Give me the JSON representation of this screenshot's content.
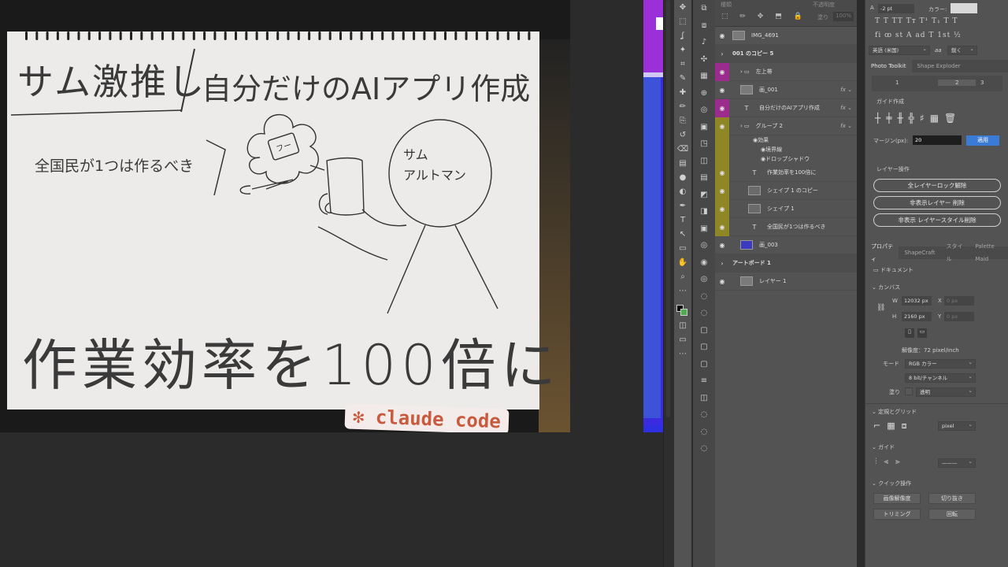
{
  "canvas": {
    "sketch": {
      "title_left": "サム激推し",
      "title_right": "自分だけのAIアプリ作成",
      "left_note": "全国民が1つは作るべき",
      "flower_label": "フー",
      "head_label": "サム\nアルトマン",
      "bottom_text": "作業効率を100倍に"
    },
    "sticker_text": "✻ claude code"
  },
  "toolbar": {
    "tools": [
      "move-icon",
      "marquee-icon",
      "lasso-icon",
      "magic-wand-icon",
      "crop-icon",
      "eyedropper-icon",
      "healing-icon",
      "brush-icon",
      "stamp-icon",
      "history-brush-icon",
      "eraser-icon",
      "gradient-icon",
      "blur-icon",
      "dodge-icon",
      "pen-icon",
      "type-icon",
      "path-select-icon",
      "rectangle-icon",
      "hand-icon",
      "zoom-icon",
      "more-icon"
    ],
    "tool_glyphs": [
      "✥",
      "⬚",
      "ʆ",
      "✦",
      "⌗",
      "✎",
      "✚",
      "✏",
      "⎘",
      "↺",
      "⌫",
      "▤",
      "●",
      "◐",
      "✒",
      "T",
      "↖",
      "▭",
      "✋",
      "⌕",
      "⋯"
    ]
  },
  "mini_panel": {
    "glyphs": [
      "⧉",
      "⧈",
      "♪",
      "✣",
      "▦",
      "⊕",
      "◎",
      "▣",
      "◳",
      "◫",
      "▤",
      "◩",
      "◨",
      "▣",
      "◎",
      "◉",
      "◎",
      "◌",
      "◌",
      "▢",
      "▢",
      "▢",
      "≡",
      "◫",
      "◌",
      "◌",
      "◌"
    ]
  },
  "layers": {
    "top_left_label": "種類",
    "top_right_label": "不透明度",
    "fill_label": "塗り",
    "fill_value": "100%",
    "lock_glyphs": "⬚ ✏ ✥ ⬒ 🔒",
    "rows": [
      {
        "name": "IMG_4691",
        "kind": "thumb",
        "indent": 0,
        "eye": true,
        "tag": "",
        "fx": false
      },
      {
        "name": "001 のコピー 5",
        "kind": "group-header",
        "indent": 0,
        "eye": false,
        "tag": "",
        "fx": false
      },
      {
        "name": "左上帯",
        "kind": "folder",
        "indent": 1,
        "eye": true,
        "tag": "#9b2b8d",
        "fx": false
      },
      {
        "name": "画_001",
        "kind": "thumb",
        "indent": 1,
        "eye": true,
        "tag": "",
        "fx": true
      },
      {
        "name": "自分だけのAIアプリ作成",
        "kind": "text",
        "indent": 1,
        "eye": true,
        "tag": "#9b2b8d",
        "fx": true
      },
      {
        "name": "グループ 2",
        "kind": "folder",
        "indent": 1,
        "eye": true,
        "tag": "#8f8726",
        "fx": true
      },
      {
        "name": "作業効率を100倍に",
        "kind": "text",
        "indent": 2,
        "eye": true,
        "tag": "#8f8726",
        "fx": false
      },
      {
        "name": "シェイプ 1 のコピー",
        "kind": "shape",
        "indent": 2,
        "eye": true,
        "tag": "#8f8726",
        "fx": false
      },
      {
        "name": "シェイプ 1",
        "kind": "shape",
        "indent": 2,
        "eye": true,
        "tag": "#8f8726",
        "fx": false
      },
      {
        "name": "全国民が1つは作るべき",
        "kind": "text",
        "indent": 2,
        "eye": true,
        "tag": "#8f8726",
        "fx": false
      },
      {
        "name": "画_003",
        "kind": "thumb",
        "indent": 1,
        "eye": true,
        "tag": "",
        "fx": false
      },
      {
        "name": "アートボード 1",
        "kind": "group-header",
        "indent": 0,
        "eye": false,
        "tag": "",
        "fx": false
      },
      {
        "name": "レイヤー 1",
        "kind": "thumb",
        "indent": 1,
        "eye": true,
        "tag": "",
        "fx": false
      }
    ],
    "effects_label": "効果",
    "effect_items": [
      "境界線",
      "ドロップシャドウ"
    ]
  },
  "right_panel": {
    "char_size": "-2 pt",
    "color_label": "カラー:",
    "type_buttons": "T T TT Tт T¹ T₁ T T",
    "glyph_buttons": "fi ꝏ st A ad T 1st ½",
    "language": "英語 (米国)",
    "aa_label": "aa",
    "antialias": "鋭く",
    "tabs1": [
      "Photo Toolkit",
      "Shape Exploder"
    ],
    "toolkit_numbers": [
      "1",
      "2",
      "3"
    ],
    "guide_label": "ガイド作成",
    "margin_label": "マージン(px):",
    "margin_value": "20",
    "apply_button": "適用",
    "layer_ops_label": "レイヤー操作",
    "buttons": [
      "全レイヤーロック解除",
      "非表示レイヤー 削除",
      "非表示 レイヤースタイル削除"
    ],
    "tabs2": [
      "プロパティ",
      "ShapeCraft",
      "スタイル",
      "Palette Maid"
    ],
    "doc_label": "ドキュメント",
    "canvas_label": "カンバス",
    "w_label": "W",
    "w_value": "12032 px",
    "h_label": "H",
    "h_value": "2160 px",
    "x_label": "X",
    "y_label": "Y",
    "x_placeholder": "0 px",
    "y_placeholder": "0 px",
    "resolution": "解像度：72 pixel/inch",
    "mode_label": "モード",
    "mode_value": "RGB カラー",
    "bits_value": "8 bit/チャンネル",
    "fill_label": "塗り",
    "fill_value": "透明",
    "rulers_label": "定規とグリッド",
    "units_value": "pixel",
    "guides_label": "ガイド",
    "quick_label": "クイック操作",
    "quick_buttons": [
      "画像解像度",
      "切り抜き",
      "トリミング",
      "回転"
    ]
  }
}
